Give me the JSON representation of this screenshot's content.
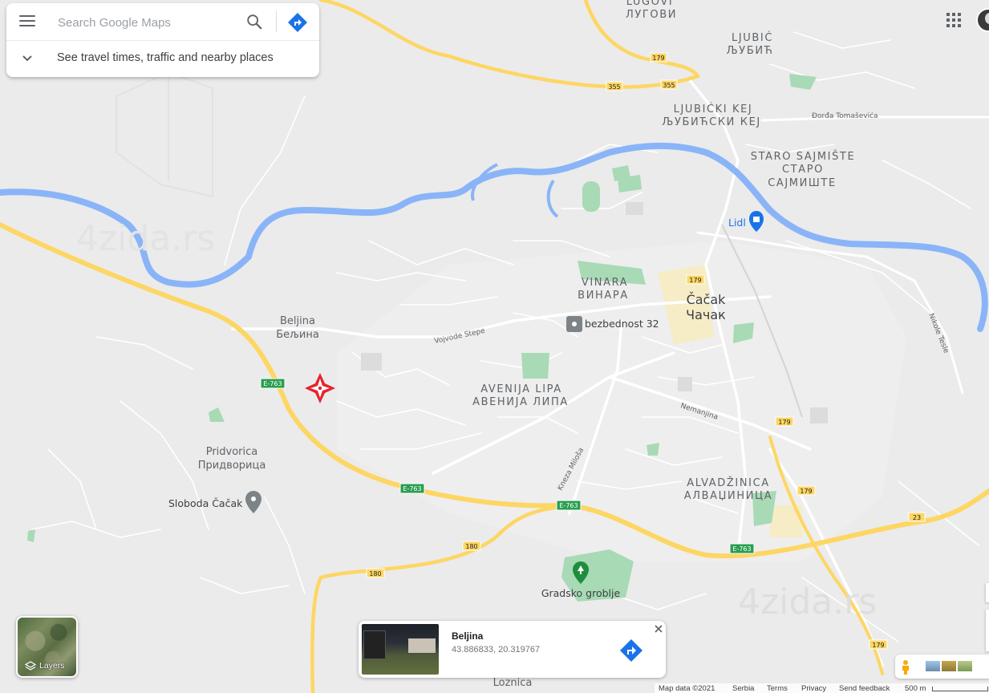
{
  "search": {
    "placeholder": "Search Google Maps",
    "travel_text": "See travel times, traffic and nearby places"
  },
  "map": {
    "city_latin": "Čačak",
    "city_cyrillic": "Чачак",
    "neighborhoods": [
      {
        "latin": "LUGOVI",
        "cyrillic": "ЛУГОВИ"
      },
      {
        "latin": "LJUBIĆ",
        "cyrillic": "ЉУБИЋ"
      },
      {
        "latin": "LJUBIĆKI KEJ",
        "cyrillic": "ЉУБИЋСКИ КЕЈ"
      },
      {
        "latin": "STARO SAJMIŠTE",
        "cyrillic": "СТАРО",
        "cyrillic2": "САЈМИШТЕ"
      },
      {
        "latin": "VINARA",
        "cyrillic": "ВИНАРА"
      },
      {
        "latin": "AVENIJA LIPA",
        "cyrillic": "АВЕНИЈА ЛИПА"
      },
      {
        "latin": "ALVADŽINICA",
        "cyrillic": "АЛВАЏИНИЦА"
      }
    ],
    "villages": [
      {
        "latin": "Beljina",
        "cyrillic": "Бељина"
      },
      {
        "latin": "Pridvorica",
        "cyrillic": "Придворица"
      },
      {
        "latin": "Loznica",
        "cyrillic": ""
      }
    ],
    "streets": [
      "Đorđa Tomaševića",
      "Vojvode Stepe",
      "Nemanjina",
      "Kneza Miloša",
      "Nikole Tesle"
    ],
    "pois": [
      {
        "name": "Lidl",
        "icon": "shopping-bag-icon"
      },
      {
        "name": "bezbednost 32",
        "icon": "building-icon"
      },
      {
        "name": "Sloboda Čačak",
        "icon": "map-pin-icon"
      },
      {
        "name": "Gradsko groblje",
        "icon": "cemetery-icon"
      }
    ],
    "shields": [
      "179",
      "355",
      "179",
      "E-763",
      "E-763",
      "E-763",
      "E-763",
      "179",
      "179",
      "23",
      "180",
      "180",
      "179"
    ],
    "watermark": "4zida.rs",
    "colors": {
      "water": "#8ab4f8",
      "highway": "#fdd663",
      "park": "#a8dab5",
      "shield_green": "#2a9e50",
      "marker_red": "#e8222a"
    }
  },
  "place_card": {
    "name": "Beljina",
    "coords": "43.886833, 20.319767"
  },
  "layers": {
    "label": "Layers"
  },
  "footer": {
    "map_data": "Map data ©2021",
    "country": "Serbia",
    "terms": "Terms",
    "privacy": "Privacy",
    "feedback": "Send feedback",
    "scale": "500 m"
  }
}
